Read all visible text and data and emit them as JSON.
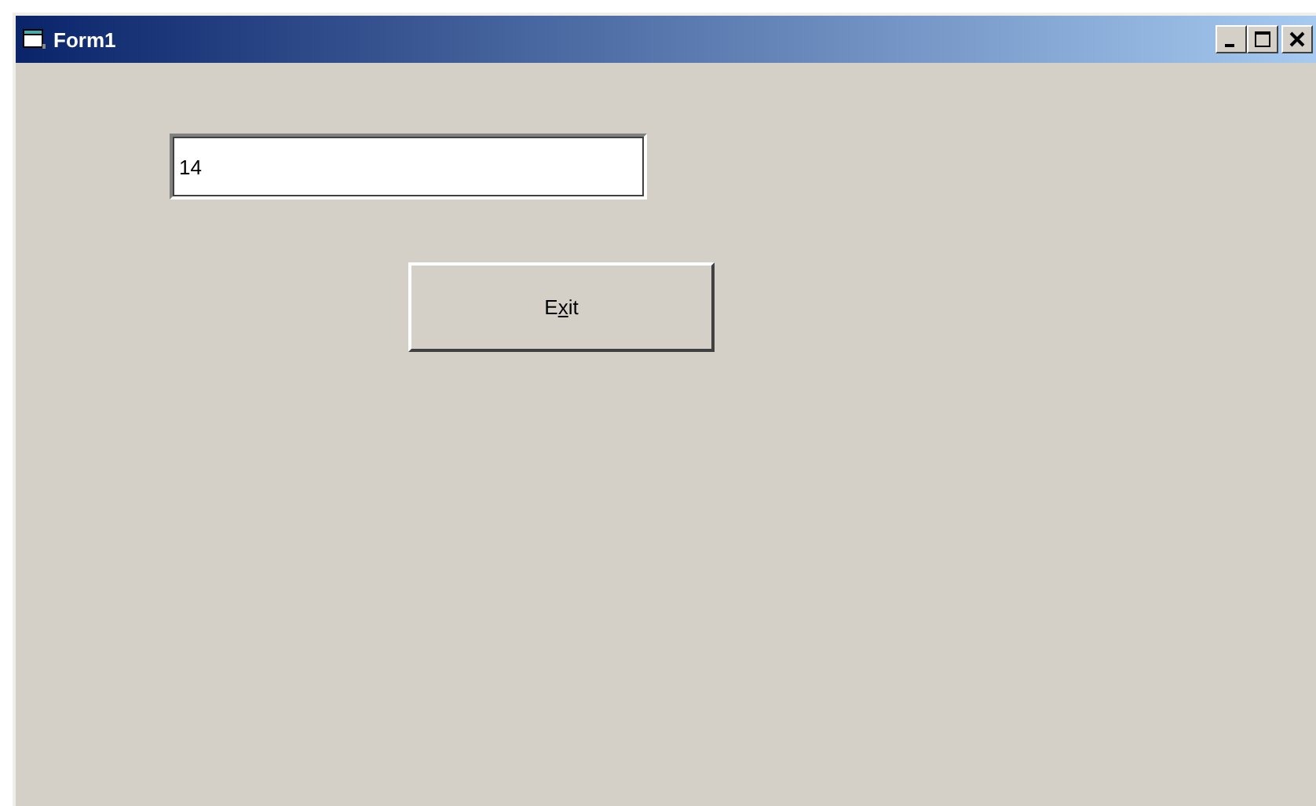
{
  "window": {
    "title": "Form1"
  },
  "text_field": {
    "value": "14"
  },
  "exit_button": {
    "label_before": "E",
    "mnemonic": "x",
    "label_after": "it"
  }
}
